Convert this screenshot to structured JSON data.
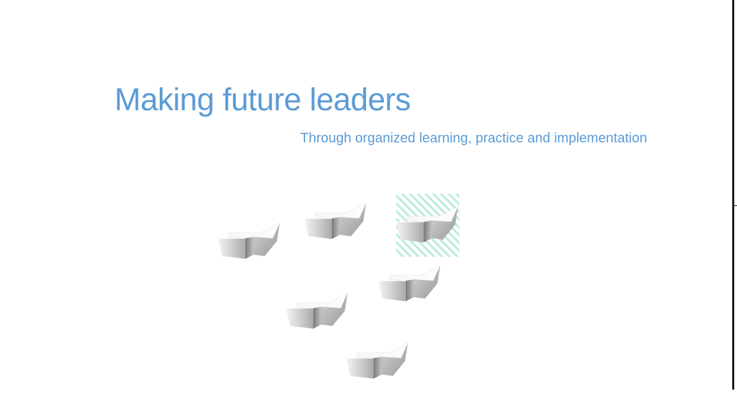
{
  "slide": {
    "title": "Making future leaders",
    "subtitle": "Through organized learning, practice and implementation"
  },
  "graphic": {
    "arrow_icon": "3d-arrow-icon",
    "arrow_count": 6,
    "selected_arrow_index": 2,
    "colors": {
      "text_accent": "#5b9bd5",
      "selection_hatch": "#b8ecd8"
    }
  }
}
